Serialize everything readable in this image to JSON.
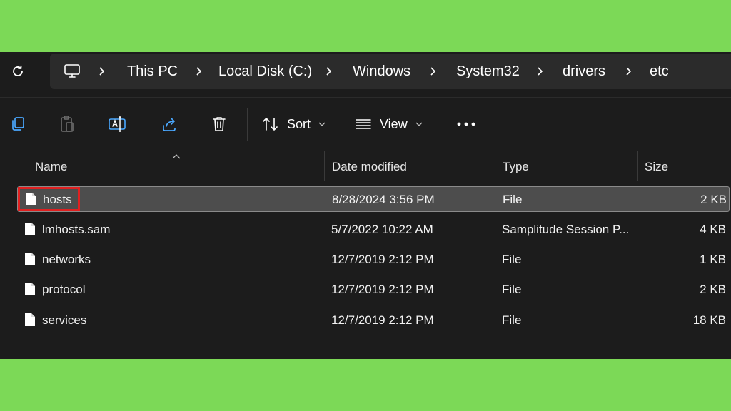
{
  "address": {
    "crumbs": [
      "This PC",
      "Local Disk (C:)",
      "Windows",
      "System32",
      "drivers",
      "etc"
    ]
  },
  "toolbar": {
    "sort_label": "Sort",
    "view_label": "View"
  },
  "columns": {
    "name": "Name",
    "date_modified": "Date modified",
    "type": "Type",
    "size": "Size"
  },
  "files": [
    {
      "name": "hosts",
      "date": "8/28/2024 3:56 PM",
      "type": "File",
      "size": "2 KB",
      "selected": true
    },
    {
      "name": "lmhosts.sam",
      "date": "5/7/2022 10:22 AM",
      "type": "Samplitude Session P...",
      "size": "4 KB"
    },
    {
      "name": "networks",
      "date": "12/7/2019 2:12 PM",
      "type": "File",
      "size": "1 KB"
    },
    {
      "name": "protocol",
      "date": "12/7/2019 2:12 PM",
      "type": "File",
      "size": "2 KB"
    },
    {
      "name": "services",
      "date": "12/7/2019 2:12 PM",
      "type": "File",
      "size": "18 KB"
    }
  ],
  "colors": {
    "background": "#7cd957",
    "window": "#1c1c1c",
    "selection": "#4d4d4d",
    "highlight_box": "#e02020"
  }
}
